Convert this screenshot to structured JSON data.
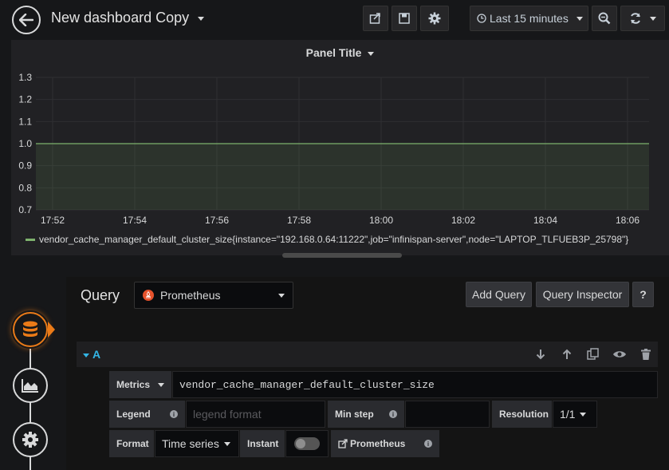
{
  "header": {
    "title": "New dashboard Copy",
    "time_range": "Last 15 minutes"
  },
  "panel": {
    "title": "Panel Title",
    "legend": "vendor_cache_manager_default_cluster_size{instance=\"192.168.0.64:11222\",job=\"infinispan-server\",node=\"LAPTOP_TLFUEB3P_25798\"}",
    "series_color": "#7eb26d"
  },
  "chart_data": {
    "type": "line",
    "x": [
      "17:52",
      "17:54",
      "17:56",
      "17:58",
      "18:00",
      "18:02",
      "18:04",
      "18:06"
    ],
    "y_ticks": [
      "1.3",
      "1.2",
      "1.1",
      "1.0",
      "0.9",
      "0.8",
      "0.7"
    ],
    "ylim": [
      0.7,
      1.3
    ],
    "series": [
      {
        "name": "vendor_cache_manager_default_cluster_size{instance=\"192.168.0.64:11222\",job=\"infinispan-server\",node=\"LAPTOP_TLFUEB3P_25798\"}",
        "values": [
          1,
          1,
          1,
          1,
          1,
          1,
          1,
          1
        ]
      }
    ],
    "grid": true,
    "legend_position": "bottom"
  },
  "editor": {
    "query_label": "Query",
    "datasource": "Prometheus",
    "add_query": "Add Query",
    "query_inspector": "Query Inspector",
    "help": "?",
    "row_label": "A",
    "metrics_label": "Metrics",
    "metrics_value": "vendor_cache_manager_default_cluster_size",
    "legend_label": "Legend",
    "legend_placeholder": "legend format",
    "min_step_label": "Min step",
    "resolution_label": "Resolution",
    "resolution_value": "1/1",
    "format_label": "Format",
    "format_value": "Time series",
    "instant_label": "Instant",
    "prometheus_link": "Prometheus"
  }
}
